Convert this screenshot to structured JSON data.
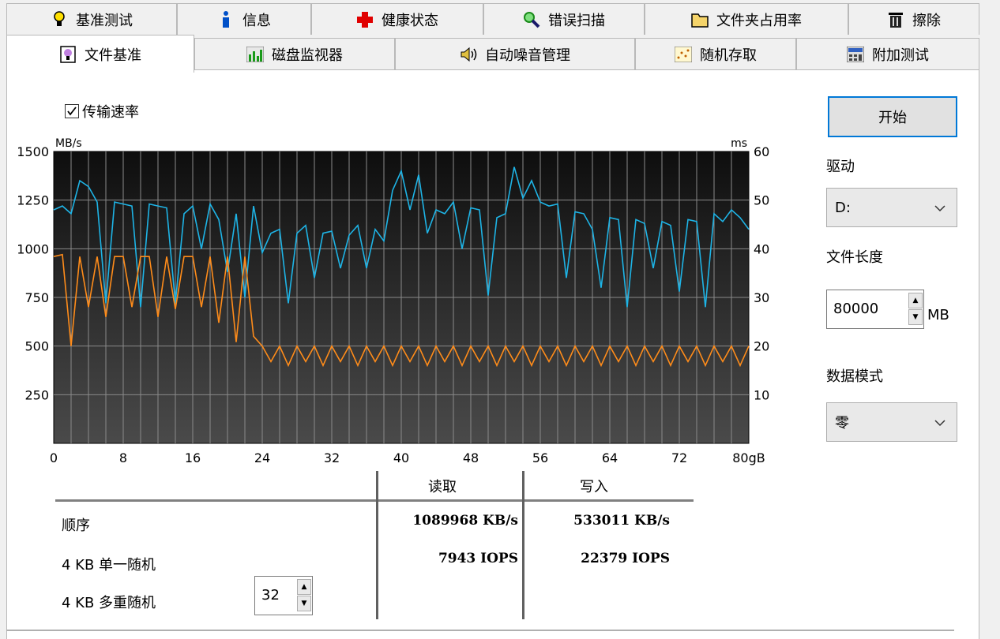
{
  "tabs_row1": [
    {
      "label": "基准测试",
      "icon": "lightbulb-icon"
    },
    {
      "label": "信息",
      "icon": "info-icon"
    },
    {
      "label": "健康状态",
      "icon": "red-cross-icon"
    },
    {
      "label": "错误扫描",
      "icon": "magnifier-icon"
    },
    {
      "label": "文件夹占用率",
      "icon": "folder-icon"
    },
    {
      "label": "擦除",
      "icon": "trash-icon"
    }
  ],
  "tabs_row2": [
    {
      "label": "文件基准",
      "icon": "file-benchmark-icon",
      "active": true
    },
    {
      "label": "磁盘监视器",
      "icon": "bar-chart-icon"
    },
    {
      "label": "自动噪音管理",
      "icon": "speaker-icon"
    },
    {
      "label": "随机存取",
      "icon": "scatter-icon"
    },
    {
      "label": "附加测试",
      "icon": "calculator-icon"
    }
  ],
  "transfer_rate_checkbox": {
    "label": "传输速率",
    "checked": true
  },
  "start_button": "开始",
  "drive": {
    "label": "驱动",
    "value": "D:"
  },
  "file_length": {
    "label": "文件长度",
    "value": "80000",
    "unit": "MB"
  },
  "data_mode": {
    "label": "数据模式",
    "value": "零"
  },
  "results": {
    "col_read": "读取",
    "col_write": "写入",
    "rows": [
      {
        "label": "顺序",
        "read": "1089968 KB/s",
        "write": "533011 KB/s"
      },
      {
        "label": "4 KB 单一随机",
        "read": "7943 IOPS",
        "write": "22379 IOPS"
      },
      {
        "label": "4 KB 多重随机",
        "read": "",
        "write": ""
      }
    ],
    "queue_depth": "32"
  },
  "colors": {
    "read_line": "#1eb4e6",
    "write_line": "#ff8c1a",
    "plot_bg": "#1a1a1a",
    "accent": "#0078d7"
  },
  "chart_data": {
    "type": "line",
    "y_left_label": "MB/s",
    "y_right_label": "ms",
    "y_left_ticks": [
      "1500",
      "1250",
      "1000",
      "750",
      "500",
      "250"
    ],
    "y_right_ticks": [
      "60",
      "50",
      "40",
      "30",
      "20",
      "10"
    ],
    "x_ticks": [
      "0",
      "8",
      "16",
      "24",
      "32",
      "40",
      "48",
      "56",
      "64",
      "72",
      "80gB"
    ],
    "xlim": [
      0,
      80
    ],
    "ylim_left": [
      0,
      1500
    ],
    "ylim_right": [
      0,
      60
    ],
    "grid": true,
    "series": [
      {
        "name": "读取",
        "color": "#1eb4e6",
        "x": [
          0,
          1,
          2,
          3,
          4,
          5,
          6,
          7,
          8,
          9,
          10,
          11,
          12,
          13,
          14,
          15,
          16,
          17,
          18,
          19,
          20,
          21,
          22,
          23,
          24,
          25,
          26,
          27,
          28,
          29,
          30,
          31,
          32,
          33,
          34,
          35,
          36,
          37,
          38,
          39,
          40,
          41,
          42,
          43,
          44,
          45,
          46,
          47,
          48,
          49,
          50,
          51,
          52,
          53,
          54,
          55,
          56,
          57,
          58,
          59,
          60,
          61,
          62,
          63,
          64,
          65,
          66,
          67,
          68,
          69,
          70,
          71,
          72,
          73,
          74,
          75,
          76,
          77,
          78,
          79,
          80
        ],
        "y": [
          1200,
          1220,
          1180,
          1350,
          1320,
          1240,
          720,
          1240,
          1230,
          1220,
          700,
          1230,
          1220,
          1210,
          720,
          1180,
          1220,
          1000,
          1230,
          1150,
          880,
          1180,
          750,
          1220,
          980,
          1080,
          1100,
          720,
          1080,
          1120,
          850,
          1080,
          1090,
          900,
          1070,
          1120,
          900,
          1100,
          1040,
          1300,
          1400,
          1200,
          1380,
          1080,
          1200,
          1180,
          1240,
          1000,
          1210,
          1200,
          760,
          1160,
          1180,
          1420,
          1260,
          1350,
          1240,
          1220,
          1230,
          850,
          1190,
          1180,
          1100,
          800,
          1160,
          1150,
          700,
          1150,
          1130,
          900,
          1140,
          1120,
          780,
          1150,
          1140,
          700,
          1180,
          1140,
          1200,
          1160,
          1100
        ]
      },
      {
        "name": "写入",
        "color": "#ff8c1a",
        "x": [
          0,
          1,
          2,
          3,
          4,
          5,
          6,
          7,
          8,
          9,
          10,
          11,
          12,
          13,
          14,
          15,
          16,
          17,
          18,
          19,
          20,
          21,
          22,
          23,
          24,
          25,
          26,
          27,
          28,
          29,
          30,
          31,
          32,
          33,
          34,
          35,
          36,
          37,
          38,
          39,
          40,
          41,
          42,
          43,
          44,
          45,
          46,
          47,
          48,
          49,
          50,
          51,
          52,
          53,
          54,
          55,
          56,
          57,
          58,
          59,
          60,
          61,
          62,
          63,
          64,
          65,
          66,
          67,
          68,
          69,
          70,
          71,
          72,
          73,
          74,
          75,
          76,
          77,
          78,
          79,
          80
        ],
        "y": [
          960,
          970,
          500,
          960,
          700,
          960,
          650,
          960,
          960,
          700,
          960,
          960,
          650,
          960,
          690,
          960,
          960,
          700,
          960,
          620,
          960,
          520,
          960,
          550,
          500,
          420,
          500,
          400,
          500,
          420,
          500,
          400,
          500,
          420,
          500,
          400,
          500,
          420,
          500,
          400,
          500,
          420,
          500,
          400,
          500,
          420,
          500,
          400,
          500,
          420,
          500,
          400,
          500,
          420,
          500,
          400,
          500,
          420,
          500,
          400,
          500,
          420,
          500,
          400,
          500,
          420,
          500,
          400,
          500,
          420,
          500,
          400,
          500,
          420,
          500,
          400,
          500,
          420,
          500,
          400,
          500
        ]
      }
    ]
  }
}
